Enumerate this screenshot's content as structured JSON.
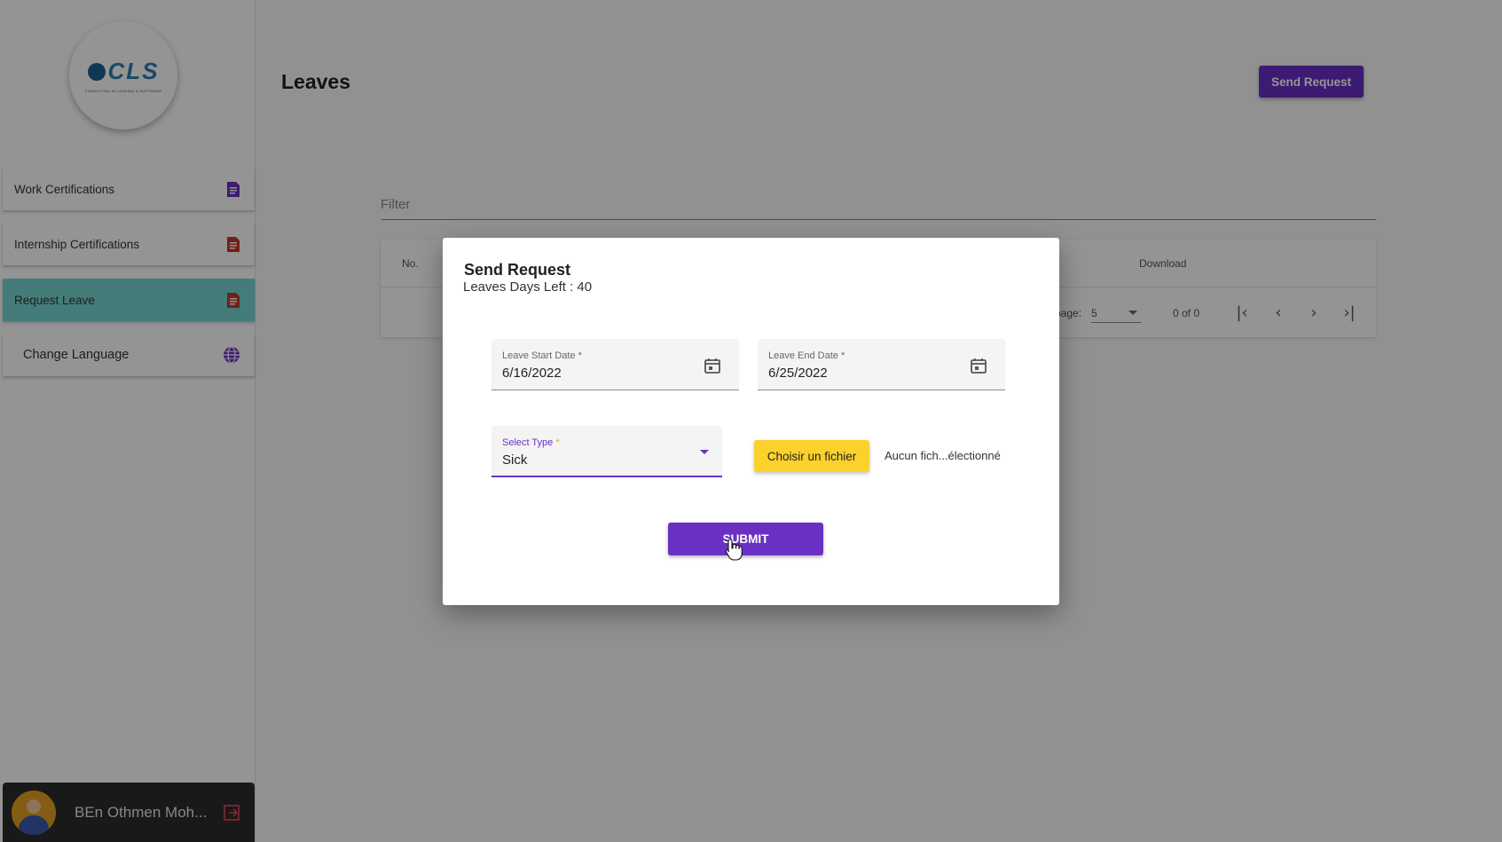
{
  "sidebar": {
    "logo_text": "CLS",
    "logo_tagline": "CONSULTING IN LEADING & SOFTWARE",
    "items": [
      {
        "label": "Work Certifications",
        "icon": "document-icon",
        "icon_color": "#6a30c4"
      },
      {
        "label": "Internship Certifications",
        "icon": "document-icon",
        "icon_color": "#c0392b"
      },
      {
        "label": "Request Leave",
        "icon": "document-icon",
        "icon_color": "#c0392b",
        "active": true
      },
      {
        "label": "Change Language",
        "icon": "globe-icon",
        "icon_color": "#6a30c4"
      }
    ],
    "user": {
      "name": "BEn Othmen Moh...",
      "logout_icon": "logout-icon"
    }
  },
  "main": {
    "title": "Leaves",
    "send_request_label": "Send Request",
    "filter_placeholder": "Filter",
    "table": {
      "columns": [
        "No.",
        "Download"
      ],
      "paginator": {
        "items_per_page_label": "page:",
        "page_size": "5",
        "range_label": "0 of 0"
      }
    }
  },
  "dialog": {
    "title": "Send Request",
    "subtitle": "Leaves Days Left : 40",
    "start_date": {
      "label": "Leave Start Date",
      "value": "6/16/2022"
    },
    "end_date": {
      "label": "Leave End Date",
      "value": "6/25/2022"
    },
    "type": {
      "label": "Select Type",
      "value": "Sick"
    },
    "required_mark": "*",
    "file_button": "Choisir un fichier",
    "file_status": "Aucun fich...électionné",
    "submit_label": "SUBMIT"
  },
  "colors": {
    "accent": "#6a30c4",
    "active_nav": "#75d6d3",
    "file_button": "#fbd22c"
  }
}
